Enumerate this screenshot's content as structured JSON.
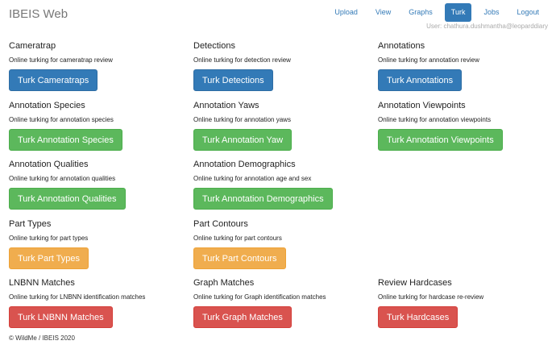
{
  "navbar": {
    "brand": "IBEIS Web",
    "links": [
      "Upload",
      "View",
      "Graphs",
      "Turk",
      "Jobs",
      "Logout"
    ],
    "active": "Turk",
    "user": "User: chathura.dushmantha@leoparddiary"
  },
  "colors": {
    "primary": "#337ab7",
    "success": "#5cb85c",
    "warning": "#f0ad4e",
    "danger": "#d9534f"
  },
  "sections": [
    {
      "title": "Cameratrap",
      "desc": "Online turking for cameratrap review",
      "button": "Turk Cameratraps",
      "style": "primary"
    },
    {
      "title": "Detections",
      "desc": "Online turking for detection review",
      "button": "Turk Detections",
      "style": "primary"
    },
    {
      "title": "Annotations",
      "desc": "Online turking for annotation review",
      "button": "Turk Annotations",
      "style": "primary"
    },
    {
      "title": "Annotation Species",
      "desc": "Online turking for annotation species",
      "button": "Turk Annotation Species",
      "style": "success"
    },
    {
      "title": "Annotation Yaws",
      "desc": "Online turking for annotation yaws",
      "button": "Turk Annotation Yaw",
      "style": "success"
    },
    {
      "title": "Annotation Viewpoints",
      "desc": "Online turking for annotation viewpoints",
      "button": "Turk Annotation Viewpoints",
      "style": "success"
    },
    {
      "title": "Annotation Qualities",
      "desc": "Online turking for annotation qualities",
      "button": "Turk Annotation Qualities",
      "style": "success"
    },
    {
      "title": "Annotation Demographics",
      "desc": "Online turking for annotation age and sex",
      "button": "Turk Annotation Demographics",
      "style": "success"
    },
    null,
    {
      "title": "Part Types",
      "desc": "Online turking for part types",
      "button": "Turk Part Types",
      "style": "warning"
    },
    {
      "title": "Part Contours",
      "desc": "Online turking for part contours",
      "button": "Turk Part Contours",
      "style": "warning"
    },
    null,
    {
      "title": "LNBNN Matches",
      "desc": "Online turking for LNBNN identification matches",
      "button": "Turk LNBNN Matches",
      "style": "danger"
    },
    {
      "title": "Graph Matches",
      "desc": "Online turking for Graph identification matches",
      "button": "Turk Graph Matches",
      "style": "danger"
    },
    {
      "title": "Review Hardcases",
      "desc": "Online turking for hardcase re-review",
      "button": "Turk Hardcases",
      "style": "danger"
    }
  ],
  "footer": "© WildMe / IBEIS 2020"
}
